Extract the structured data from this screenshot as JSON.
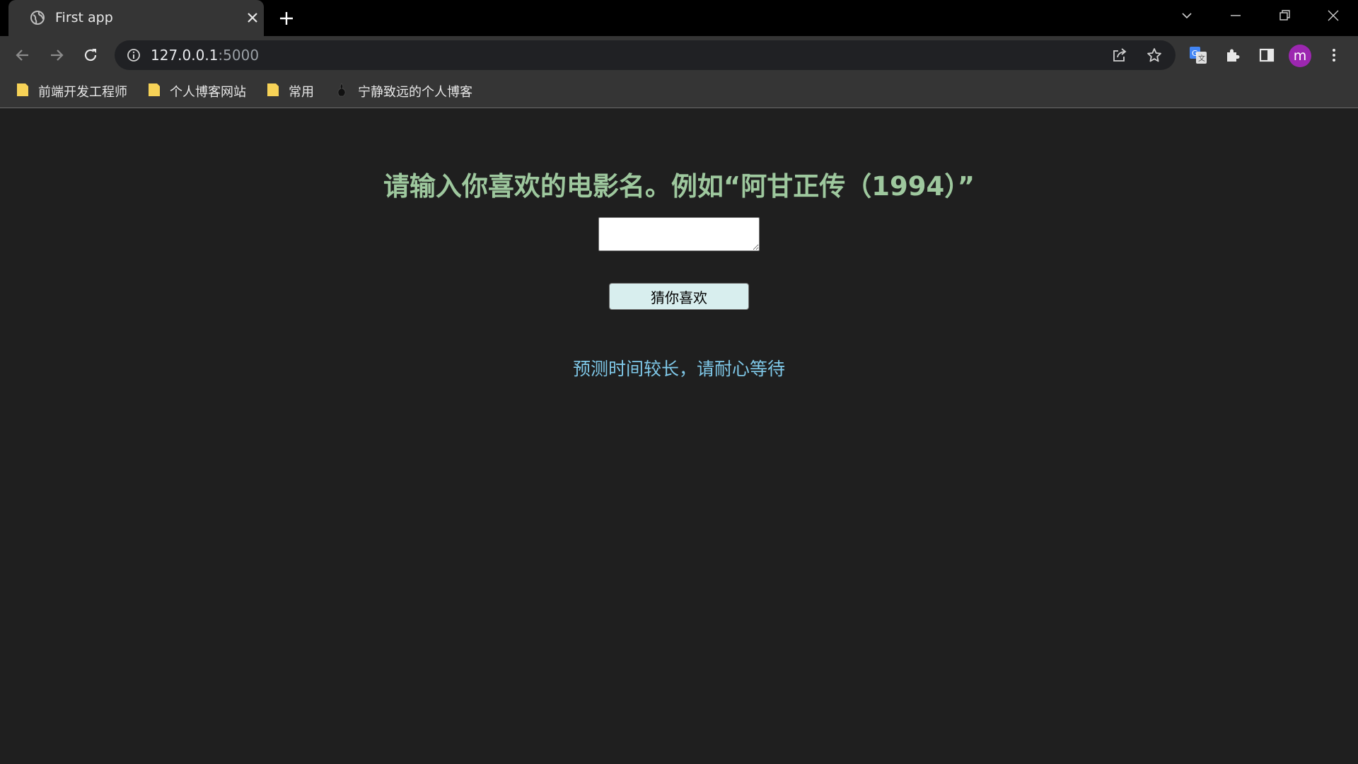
{
  "browser": {
    "tab": {
      "title": "First app",
      "favicon": "globe-icon"
    },
    "address": {
      "host": "127.0.0.1",
      "port": ":5000"
    },
    "profile_initial": "m",
    "bookmarks": [
      {
        "label": "前端开发工程师",
        "icon": "folder-icon"
      },
      {
        "label": "个人博客网站",
        "icon": "folder-icon"
      },
      {
        "label": "常用",
        "icon": "folder-icon"
      },
      {
        "label": "宁静致远的个人博客",
        "icon": "site-favicon-icon"
      }
    ]
  },
  "page": {
    "heading": "请输入你喜欢的电影名。例如“阿甘正传（1994）”",
    "input": {
      "value": "",
      "placeholder": ""
    },
    "button_label": "猜你喜欢",
    "note": "预测时间较长，请耐心等待"
  },
  "colors": {
    "page_bg": "#1f1f1f",
    "heading": "#9ec89e",
    "button_bg": "#d8eeee",
    "note": "#7fc8e8",
    "avatar": "#9c27b0"
  }
}
